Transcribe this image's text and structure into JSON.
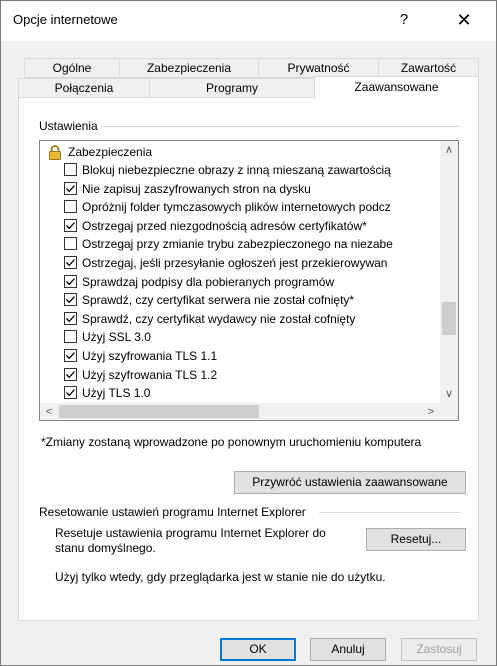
{
  "window": {
    "title": "Opcje internetowe",
    "help_glyph": "?",
    "close_glyph": "✕"
  },
  "tabs": {
    "top_row": [
      "Ogólne",
      "Zabezpieczenia",
      "Prywatność",
      "Zawartość"
    ],
    "bottom_row": [
      "Połączenia",
      "Programy",
      "Zaawansowane"
    ],
    "active": "Zaawansowane"
  },
  "settings": {
    "group_label": "Ustawienia",
    "category": "Zabezpieczenia",
    "category_icon": "padlock-icon",
    "items": [
      {
        "label": "Blokuj niebezpieczne obrazy z inną mieszaną zawartością",
        "checked": false
      },
      {
        "label": "Nie zapisuj zaszyfrowanych stron na dysku",
        "checked": true
      },
      {
        "label": "Opróżnij folder tymczasowych plików internetowych podcz",
        "checked": false
      },
      {
        "label": "Ostrzegaj przed niezgodnością adresów certyfikatów*",
        "checked": true
      },
      {
        "label": "Ostrzegaj przy zmianie trybu zabezpieczonego na niezabe",
        "checked": false
      },
      {
        "label": "Ostrzegaj, jeśli przesyłanie ogłoszeń jest przekierowywan",
        "checked": true
      },
      {
        "label": "Sprawdzaj podpisy dla pobieranych programów",
        "checked": true
      },
      {
        "label": "Sprawdź, czy certyfikat serwera nie został cofnięty*",
        "checked": true
      },
      {
        "label": "Sprawdź, czy certyfikat wydawcy nie został cofnięty",
        "checked": true
      },
      {
        "label": "Użyj SSL 3.0",
        "checked": false
      },
      {
        "label": "Użyj szyfrowania TLS 1.1",
        "checked": true
      },
      {
        "label": "Użyj szyfrowania TLS 1.2",
        "checked": true
      },
      {
        "label": "Użyj TLS 1.0",
        "checked": true
      }
    ]
  },
  "restart_note": "*Zmiany zostaną wprowadzone po ponownym uruchomieniu komputera",
  "restore_button": "Przywróć ustawienia zaawansowane",
  "reset_group": {
    "label": "Resetowanie ustawień programu Internet Explorer",
    "description": "Resetuje ustawienia programu Internet Explorer do stanu domyślnego.",
    "reset_button": "Resetuj...",
    "warning": "Użyj tylko wtedy, gdy przeglądarka jest w stanie nie do użytku."
  },
  "footer": {
    "ok": "OK",
    "cancel": "Anuluj",
    "apply": "Zastosuj"
  }
}
